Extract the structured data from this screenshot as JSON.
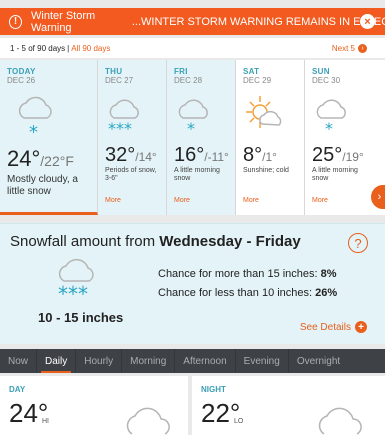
{
  "warning": {
    "title": "Winter Storm Warning",
    "text": "...WINTER STORM WARNING REMAINS IN EFFECT ...",
    "close_glyph": "×",
    "alert_glyph": "!"
  },
  "pager": {
    "range": "1 - 5 of 90 days",
    "separator": "|",
    "all_label": "All 90 days",
    "next_label": "Next 5",
    "next_glyph": "›"
  },
  "days": [
    {
      "name": "TODAY",
      "date": "DEC 26",
      "hi": "24°",
      "lo": "/22°F",
      "condition": "Mostly cloudy, a little snow",
      "icon": "cloud-snow-icon"
    },
    {
      "name": "THU",
      "date": "DEC 27",
      "hi": "32°",
      "lo": "/14°",
      "condition": "Periods of snow, 3-6\"",
      "more": "More",
      "icon": "cloud-heavy-snow-icon"
    },
    {
      "name": "FRI",
      "date": "DEC 28",
      "hi": "16°",
      "lo": "/-11°",
      "condition": "A little morning snow",
      "more": "More",
      "icon": "cloud-snow-icon"
    },
    {
      "name": "SAT",
      "date": "DEC 29",
      "hi": "8°",
      "lo": "/1°",
      "condition": "Sunshine; cold",
      "more": "More",
      "icon": "sun-cloud-icon"
    },
    {
      "name": "SUN",
      "date": "DEC 30",
      "hi": "25°",
      "lo": "/19°",
      "condition": "A little morning snow",
      "more": "More",
      "icon": "cloud-snow-icon"
    }
  ],
  "strip_arrow": "›",
  "snowfall": {
    "headline_prefix": "Snowfall amount from ",
    "headline_range": "Wednesday - Friday",
    "help_glyph": "?",
    "amount": "10 - 15 inches",
    "chance_more_label": "Chance for more than 15 inches: ",
    "chance_more_value": "8%",
    "chance_less_label": "Chance for less than 10 inches: ",
    "chance_less_value": "26%",
    "details_label": "See Details",
    "details_glyph": "+"
  },
  "tabs": [
    "Now",
    "Daily",
    "Hourly",
    "Morning",
    "Afternoon",
    "Evening",
    "Overnight"
  ],
  "active_tab": "Daily",
  "cards": {
    "day": {
      "label": "DAY",
      "temp": "24°",
      "suffix": "HI"
    },
    "night": {
      "label": "NIGHT",
      "temp": "22°",
      "suffix": "LO"
    }
  },
  "colors": {
    "accent": "#e8601c",
    "warning_bg": "#f25a1f",
    "teal": "#3aa0b6",
    "panel_bg": "#e4f3f7",
    "tab_bg": "#3e4247"
  }
}
